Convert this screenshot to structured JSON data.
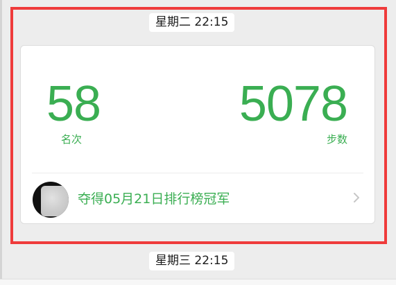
{
  "timestamps": {
    "top": "星期二 22:15",
    "bottom": "星期三 22:15"
  },
  "card": {
    "rank_value": "58",
    "rank_label": "名次",
    "steps_value": "5078",
    "steps_label": "步数",
    "champion_text": "夺得05月21日排行榜冠军",
    "avatar_icon": "avatar-blurred",
    "chevron_icon": "chevron-right-icon"
  },
  "colors": {
    "accent_green": "#3aae52",
    "highlight_red": "#ef3b3b",
    "background": "#ededed"
  }
}
